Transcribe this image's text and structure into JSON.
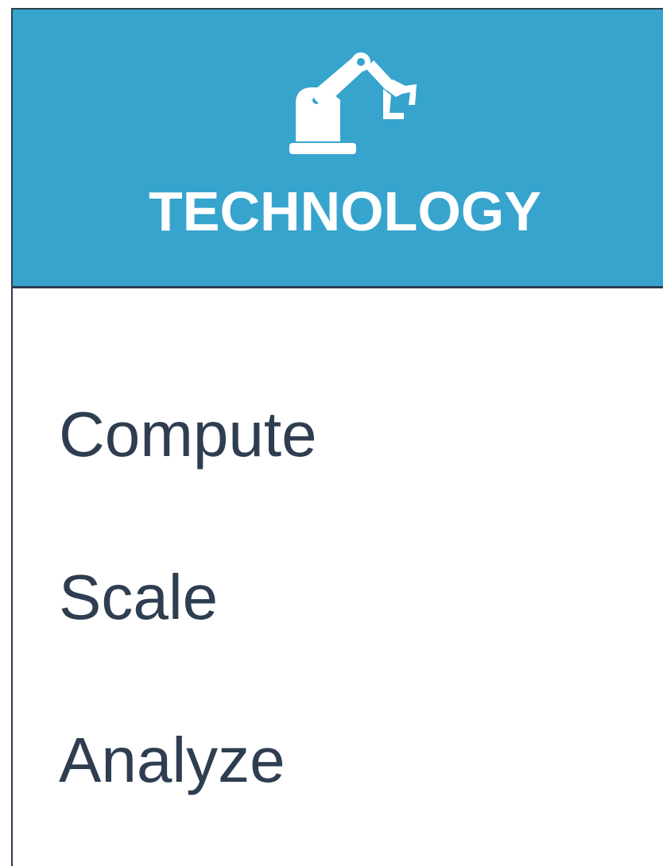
{
  "header": {
    "icon": "robot-arm-icon",
    "title": "TECHNOLOGY",
    "background_color": "#37a4cd",
    "title_color": "#ffffff"
  },
  "menu": {
    "items": [
      {
        "label": "Compute"
      },
      {
        "label": "Scale"
      },
      {
        "label": "Analyze"
      }
    ],
    "text_color": "#2e3e50"
  }
}
